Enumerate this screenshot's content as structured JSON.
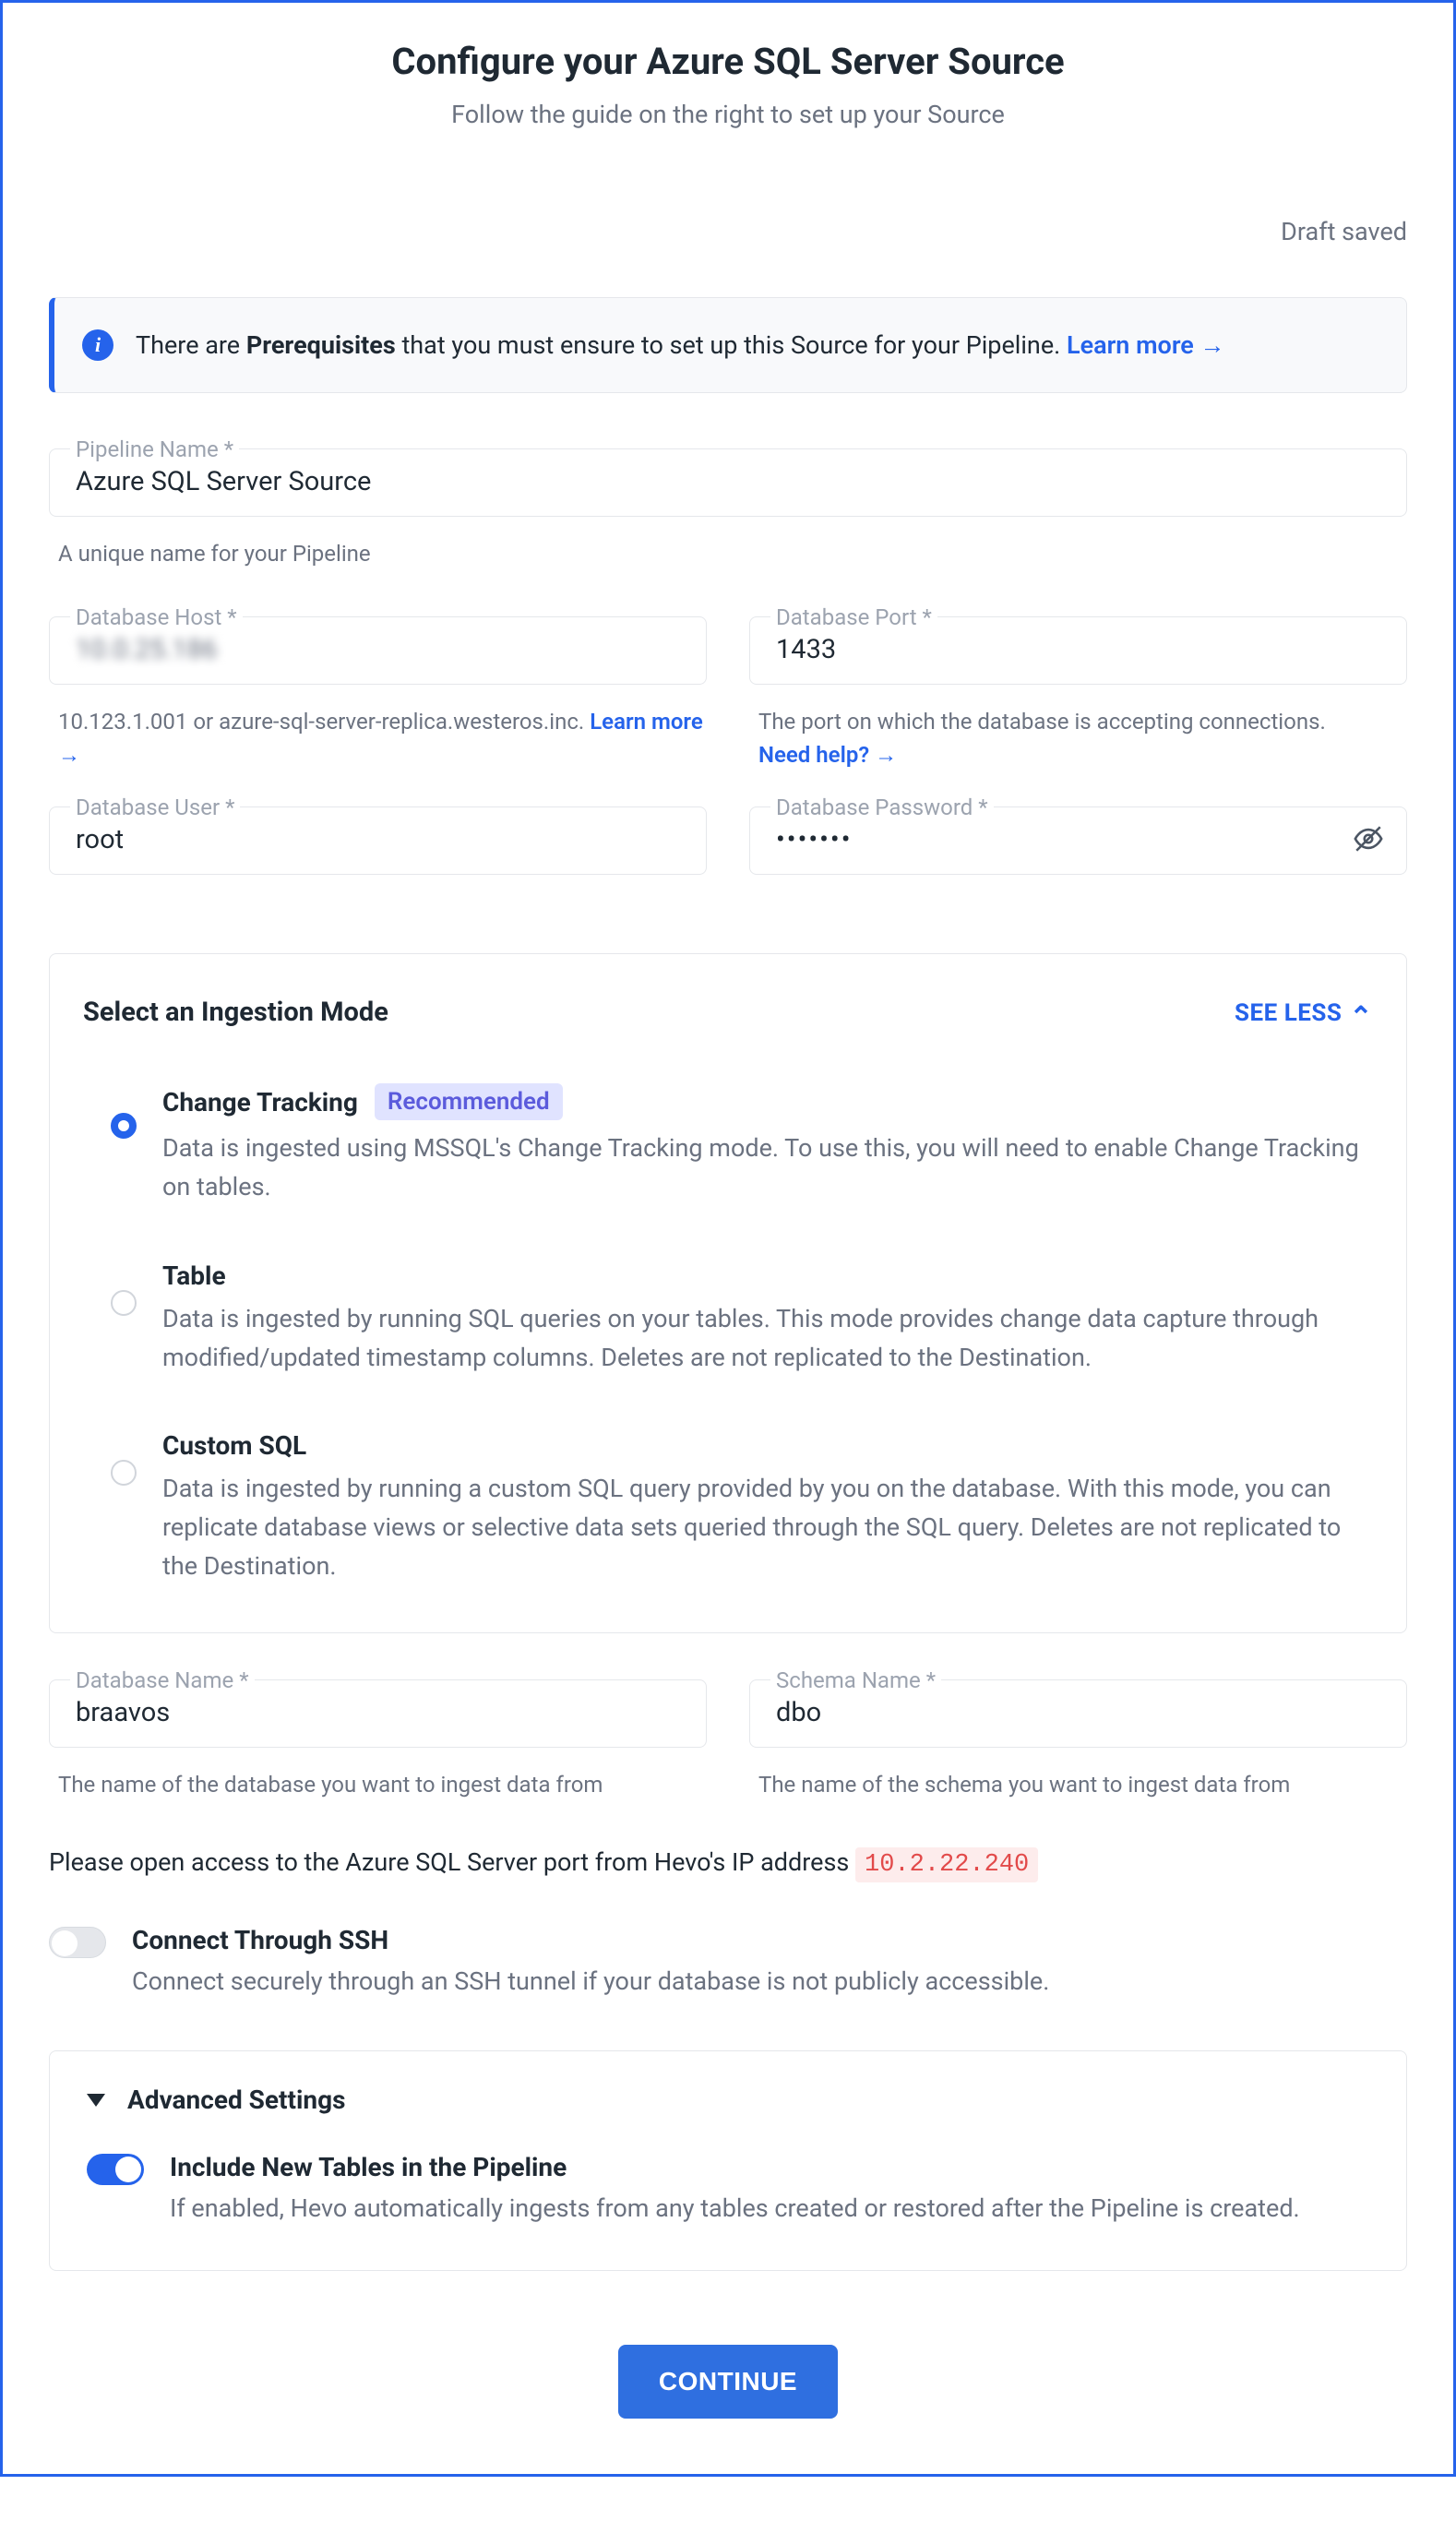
{
  "header": {
    "title": "Configure your Azure SQL Server Source",
    "subtitle": "Follow the guide on the right to set up your Source",
    "draft_status": "Draft saved"
  },
  "banner": {
    "text_pre": "There are ",
    "text_bold": "Prerequisites",
    "text_post": " that you must ensure to set up this Source for your Pipeline.  ",
    "learn_more": "Learn more"
  },
  "fields": {
    "pipeline_name": {
      "label": "Pipeline Name *",
      "value": "Azure SQL Server Source",
      "helper": "A unique name for your Pipeline"
    },
    "db_host": {
      "label": "Database Host *",
      "value": "10.0.25.186",
      "helper_pre": "10.123.1.001 or azure-sql-server-replica.westeros.inc. ",
      "helper_link": "Learn more"
    },
    "db_port": {
      "label": "Database Port *",
      "value": "1433",
      "helper_pre": "The port on which the database is accepting connections.",
      "helper_link": "Need help?"
    },
    "db_user": {
      "label": "Database User *",
      "value": "root"
    },
    "db_password": {
      "label": "Database Password *",
      "value": "•••••••"
    },
    "db_name": {
      "label": "Database Name *",
      "value": "braavos",
      "helper": "The name of the database you want to ingest data from"
    },
    "schema_name": {
      "label": "Schema Name *",
      "value": "dbo",
      "helper": "The name of the schema you want to ingest data from"
    }
  },
  "ingestion": {
    "title": "Select an Ingestion Mode",
    "toggle_label": "SEE LESS",
    "recommended_badge": "Recommended",
    "options": [
      {
        "title": "Change Tracking",
        "desc": "Data is ingested using MSSQL's Change Tracking mode. To use this, you will need to enable Change Tracking on tables.",
        "selected": true,
        "recommended": true
      },
      {
        "title": "Table",
        "desc": "Data is ingested by running SQL queries on your tables. This mode provides change data capture through modified/updated timestamp columns. Deletes are not replicated to the Destination.",
        "selected": false,
        "recommended": false
      },
      {
        "title": "Custom SQL",
        "desc": "Data is ingested by running a custom SQL query provided by you on the database. With this mode, you can replicate database views or selective data sets queried through the SQL query. Deletes are not replicated to the Destination.",
        "selected": false,
        "recommended": false
      }
    ]
  },
  "ip_notice": {
    "text": "Please open access to the Azure SQL Server port from Hevo's IP address ",
    "ip": "10.2.22.240"
  },
  "ssh": {
    "title": "Connect Through SSH",
    "desc": "Connect securely through an SSH tunnel if your database is not publicly accessible."
  },
  "advanced": {
    "title": "Advanced Settings",
    "include_new": {
      "title": "Include New Tables in the Pipeline",
      "desc": "If enabled, Hevo automatically ingests from any tables created or restored after the Pipeline is created."
    }
  },
  "actions": {
    "continue": "CONTINUE"
  }
}
